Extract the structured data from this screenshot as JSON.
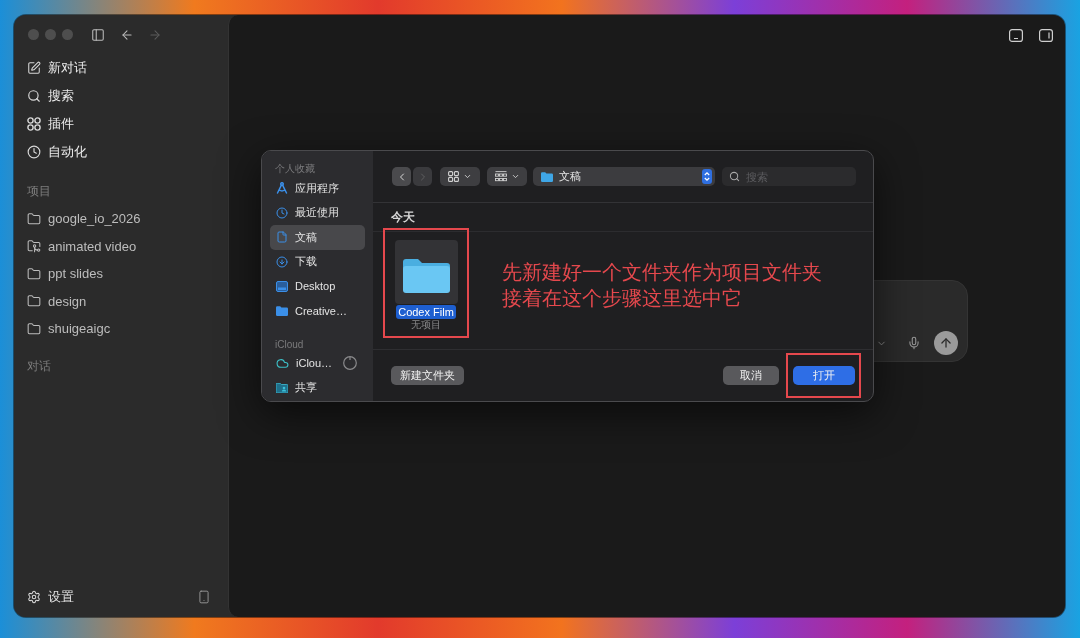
{
  "sidebar": {
    "nav": [
      {
        "label": "新对话"
      },
      {
        "label": "搜索"
      },
      {
        "label": "插件"
      },
      {
        "label": "自动化"
      }
    ],
    "sections": [
      {
        "title": "项目",
        "items": [
          {
            "label": "google_io_2026",
            "kind": "folder"
          },
          {
            "label": "animated video",
            "kind": "branch-folder"
          },
          {
            "label": "ppt slides",
            "kind": "folder"
          },
          {
            "label": "design",
            "kind": "folder"
          },
          {
            "label": "shuigeaigc",
            "kind": "folder"
          }
        ]
      },
      {
        "title": "对话"
      }
    ],
    "footer": {
      "label": "设置"
    }
  },
  "dialog": {
    "sidebar": [
      {
        "title": "个人收藏",
        "items": [
          {
            "label": "应用程序",
            "selected": false
          },
          {
            "label": "最近使用",
            "selected": false
          },
          {
            "label": "文稿",
            "selected": true
          },
          {
            "label": "下载",
            "selected": false
          },
          {
            "label": "Desktop",
            "selected": false
          },
          {
            "label": "Creative…",
            "selected": false
          }
        ]
      },
      {
        "title": "iCloud",
        "items": [
          {
            "label": "iClou…",
            "selected": false
          },
          {
            "label": "共享",
            "selected": false
          }
        ]
      }
    ],
    "location": "文稿",
    "search": {
      "placeholder": "搜索"
    },
    "group": {
      "title": "今天",
      "files": [
        {
          "name": "Codex Film",
          "detail": "无项目",
          "selected": true,
          "highlighted": true
        }
      ]
    },
    "buttons": [
      {
        "label": "新建文件夹",
        "kind": "secondary",
        "highlighted": false
      },
      {
        "label": "取消",
        "kind": "secondary",
        "highlighted": false
      },
      {
        "label": "打开",
        "kind": "primary",
        "highlighted": true
      }
    ]
  },
  "annotation": {
    "lines": [
      "先新建好一个文件夹作为项目文件夹",
      "接着在这个步骤这里选中它"
    ]
  }
}
